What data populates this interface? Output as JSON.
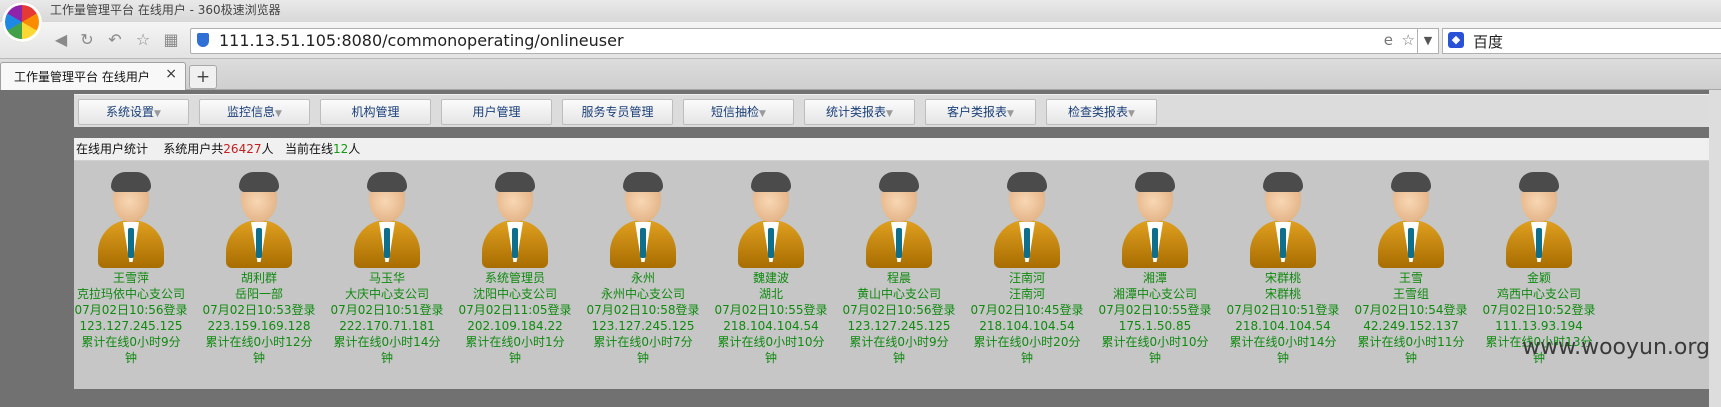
{
  "browser": {
    "window_title": "工作量管理平台 在线用户 - 360极速浏览器",
    "url": "111.13.51.105:8080/commonoperating/onlineuser",
    "search_engine": "百度"
  },
  "tab": {
    "title": "工作量管理平台 在线用户",
    "close": "×",
    "new_tab": "+"
  },
  "menu": [
    {
      "label": "系统设置",
      "arrow": "▼"
    },
    {
      "label": "监控信息",
      "arrow": "▼"
    },
    {
      "label": "机构管理",
      "arrow": ""
    },
    {
      "label": "用户管理",
      "arrow": ""
    },
    {
      "label": "服务专员管理",
      "arrow": ""
    },
    {
      "label": "短信抽检",
      "arrow": "▼"
    },
    {
      "label": "统计类报表",
      "arrow": "▼"
    },
    {
      "label": "客户类报表",
      "arrow": "▼"
    },
    {
      "label": "检查类报表",
      "arrow": "▼"
    }
  ],
  "stats": {
    "label": "在线用户统计",
    "total_prefix": "系统用户共",
    "total_count": "26427",
    "total_suffix": "人",
    "online_prefix": "当前在线",
    "online_count": "12",
    "online_suffix": "人"
  },
  "users": [
    {
      "name": "王雪萍",
      "org": "克拉玛依中心支公司",
      "login": "07月02日10:56登录",
      "ip": "123.127.245.125",
      "duration": "累计在线0小时9分钟"
    },
    {
      "name": "胡利群",
      "org": "岳阳一部",
      "login": "07月02日10:53登录",
      "ip": "223.159.169.128",
      "duration": "累计在线0小时12分钟"
    },
    {
      "name": "马玉华",
      "org": "大庆中心支公司",
      "login": "07月02日10:51登录",
      "ip": "222.170.71.181",
      "duration": "累计在线0小时14分钟"
    },
    {
      "name": "系统管理员",
      "org": "沈阳中心支公司",
      "login": "07月02日11:05登录",
      "ip": "202.109.184.22",
      "duration": "累计在线0小时1分钟"
    },
    {
      "name": "永州",
      "org": "永州中心支公司",
      "login": "07月02日10:58登录",
      "ip": "123.127.245.125",
      "duration": "累计在线0小时7分钟"
    },
    {
      "name": "魏建波",
      "org": "湖北",
      "login": "07月02日10:55登录",
      "ip": "218.104.104.54",
      "duration": "累计在线0小时10分钟"
    },
    {
      "name": "程晨",
      "org": "黄山中心支公司",
      "login": "07月02日10:56登录",
      "ip": "123.127.245.125",
      "duration": "累计在线0小时9分钟"
    },
    {
      "name": "汪南河",
      "org": "汪南河",
      "login": "07月02日10:45登录",
      "ip": "218.104.104.54",
      "duration": "累计在线0小时20分钟"
    },
    {
      "name": "湘潭",
      "org": "湘潭中心支公司",
      "login": "07月02日10:55登录",
      "ip": "175.1.50.85",
      "duration": "累计在线0小时10分钟"
    },
    {
      "name": "宋群桃",
      "org": "宋群桃",
      "login": "07月02日10:51登录",
      "ip": "218.104.104.54",
      "duration": "累计在线0小时14分钟"
    },
    {
      "name": "王雪",
      "org": "王雪组",
      "login": "07月02日10:54登录",
      "ip": "42.249.152.137",
      "duration": "累计在线0小时11分钟"
    },
    {
      "name": "金颖",
      "org": "鸡西中心支公司",
      "login": "07月02日10:52登录",
      "ip": "111.13.93.194",
      "duration": "累计在线0小时13分钟"
    }
  ],
  "watermark": "www.wooyun.org"
}
